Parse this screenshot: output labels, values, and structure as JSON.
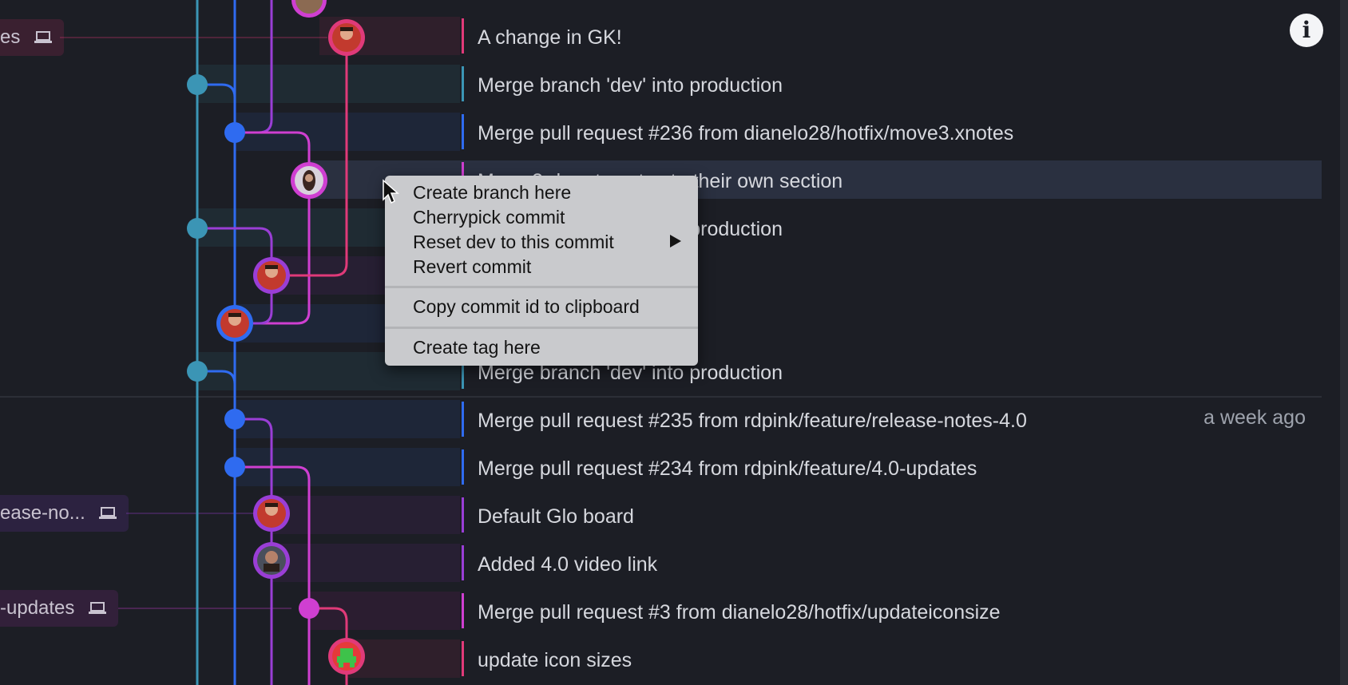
{
  "commits": [
    {
      "message": "A change in GK!"
    },
    {
      "message": "Merge branch 'dev' into production"
    },
    {
      "message": "Merge pull request #236 from dianelo28/hotfix/move3.xnotes"
    },
    {
      "message": "Move 3rd party notes to their own section"
    },
    {
      "message": "Merge branch 'dev' into production"
    },
    {
      "message": ""
    },
    {
      "message": ""
    },
    {
      "message": "Merge branch 'dev' into production"
    },
    {
      "message": "Merge pull request #235 from rdpink/feature/release-notes-4.0",
      "time": "a week ago"
    },
    {
      "message": "Merge pull request #234 from rdpink/feature/4.0-updates"
    },
    {
      "message": "Default Glo board"
    },
    {
      "message": "Added 4.0 video link"
    },
    {
      "message": "Merge pull request #3 from dianelo28/hotfix/updateiconsize"
    },
    {
      "message": "update icon sizes"
    }
  ],
  "branch_tags": [
    {
      "label": "es"
    },
    {
      "label": "ease-no..."
    },
    {
      "label": "-updates"
    }
  ],
  "context_menu": {
    "create_branch": "Create branch here",
    "cherrypick": "Cherrypick commit",
    "reset": "Reset dev to this commit",
    "revert": "Revert commit",
    "copy_id": "Copy commit id to clipboard",
    "create_tag": "Create tag here"
  },
  "info_button": {
    "label": "i"
  },
  "colors": {
    "background": "#1c1e25",
    "lane_teal": "#3b95b5",
    "lane_blue": "#2f6bf0",
    "lane_purple": "#9a3ed6",
    "lane_magenta": "#cf3fd1",
    "lane_pink": "#e03a79",
    "menu_bg": "#c9cacd"
  }
}
